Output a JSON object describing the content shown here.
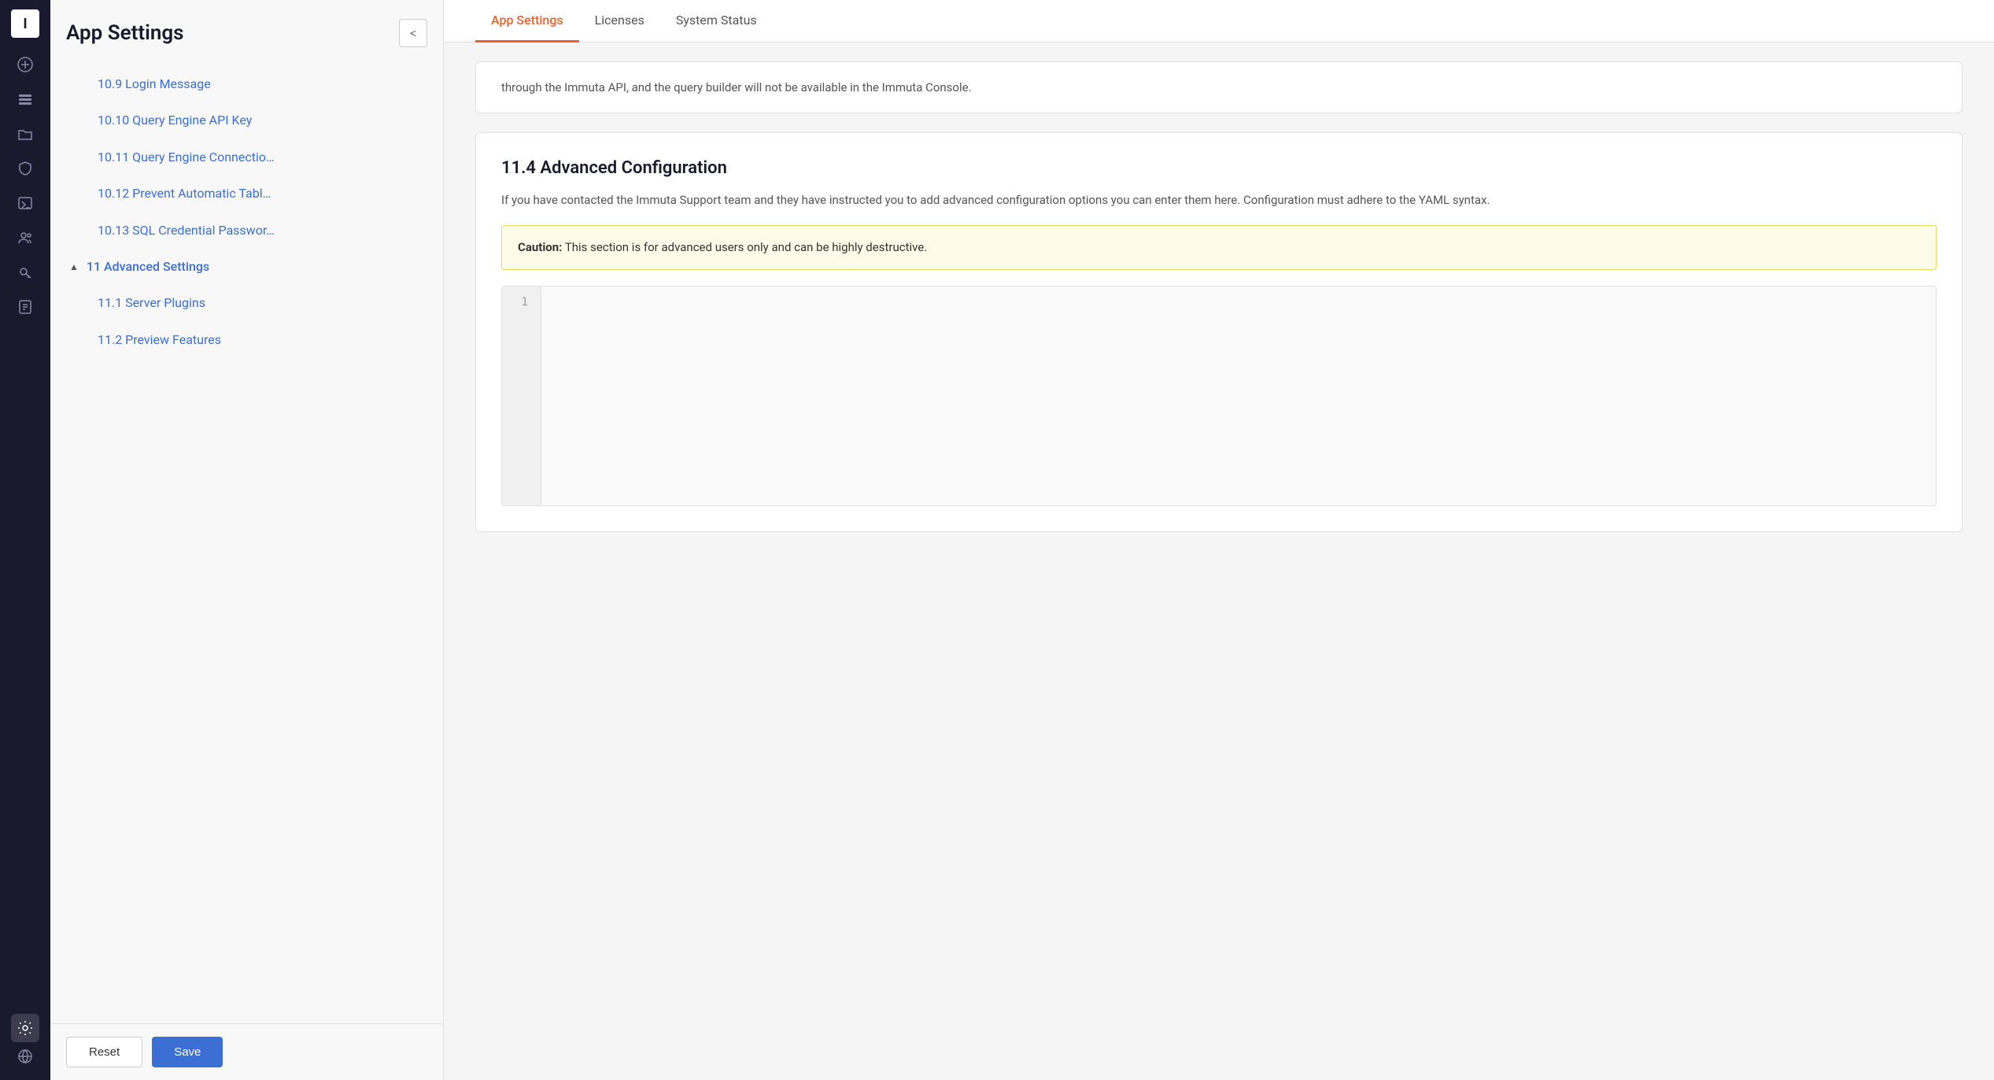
{
  "app": {
    "logo": "I",
    "title": "App Settings"
  },
  "nav": {
    "icons": [
      {
        "name": "add-icon",
        "symbol": "+"
      },
      {
        "name": "layers-icon",
        "symbol": "⊞"
      },
      {
        "name": "folder-icon",
        "symbol": "🗂"
      },
      {
        "name": "shield-icon",
        "symbol": "🛡"
      },
      {
        "name": "terminal-icon",
        "symbol": ">_"
      },
      {
        "name": "users-icon",
        "symbol": "👥"
      },
      {
        "name": "key-icon",
        "symbol": "🔑"
      },
      {
        "name": "notes-icon",
        "symbol": "📋"
      },
      {
        "name": "settings-icon",
        "symbol": "⚙"
      },
      {
        "name": "globe-icon",
        "symbol": "🌐"
      }
    ]
  },
  "sidebar": {
    "title": "App Settings",
    "collapse_label": "<",
    "items": [
      {
        "id": "10.9",
        "label": "10.9   Login Message",
        "sub": true
      },
      {
        "id": "10.10",
        "label": "10.10   Query Engine API Key",
        "sub": true
      },
      {
        "id": "10.11",
        "label": "10.11   Query Engine Connectio…",
        "sub": true
      },
      {
        "id": "10.12",
        "label": "10.12   Prevent Automatic Tabl…",
        "sub": true
      },
      {
        "id": "10.13",
        "label": "10.13   SQL Credential Passwor…",
        "sub": true
      },
      {
        "id": "11",
        "label": "11   Advanced Settings",
        "section": true,
        "expanded": true
      },
      {
        "id": "11.1",
        "label": "11.1   Server Plugins",
        "sub": true
      },
      {
        "id": "11.2",
        "label": "11.2   Preview Features",
        "sub": true
      }
    ],
    "footer": {
      "reset_label": "Reset",
      "save_label": "Save"
    }
  },
  "tabs": [
    {
      "id": "app-settings",
      "label": "App Settings",
      "active": true
    },
    {
      "id": "licenses",
      "label": "Licenses",
      "active": false
    },
    {
      "id": "system-status",
      "label": "System Status",
      "active": false
    }
  ],
  "intro_card": {
    "text": "through the Immuta API, and the query builder will not be available in the Immuta Console."
  },
  "advanced_config": {
    "title": "11.4 Advanced Configuration",
    "description": "If you have contacted the Immuta Support team and they have instructed you to add advanced configuration options you can enter them here. Configuration must adhere to the YAML syntax.",
    "caution": {
      "label": "Caution:",
      "text": " This section is for advanced users only and can be highly destructive."
    },
    "editor": {
      "line_number": "1",
      "value": ""
    }
  }
}
